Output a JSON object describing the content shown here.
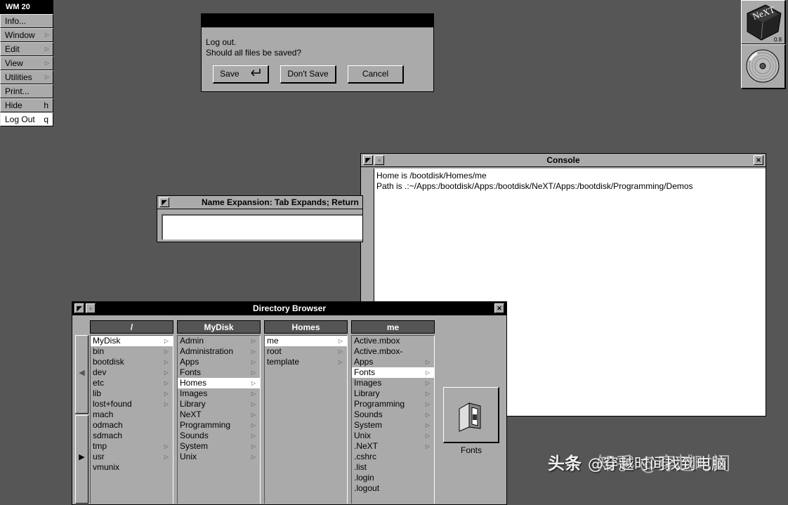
{
  "menu": {
    "title": "WM 20",
    "items": [
      {
        "label": "Info...",
        "key": "",
        "submenu": false
      },
      {
        "label": "Window",
        "key": "",
        "submenu": true
      },
      {
        "label": "Edit",
        "key": "",
        "submenu": true
      },
      {
        "label": "View",
        "key": "",
        "submenu": true
      },
      {
        "label": "Utilities",
        "key": "",
        "submenu": true
      },
      {
        "label": "Print...",
        "key": "",
        "submenu": false
      },
      {
        "label": "Hide",
        "key": "h",
        "submenu": false
      },
      {
        "label": "Log Out",
        "key": "q",
        "submenu": false
      }
    ]
  },
  "dialog": {
    "line1": "Log out.",
    "line2": "Should all files be saved?",
    "save": "Save",
    "dont_save": "Don't Save",
    "cancel": "Cancel"
  },
  "logo": {
    "text": "NeXT",
    "version": "0.8"
  },
  "console": {
    "title": "Console",
    "line1": "Home is /bootdisk/Homes/me",
    "line2": "Path is .:~/Apps:/bootdisk/Apps:/bootdisk/NeXT/Apps:/bootdisk/Programming/Demos"
  },
  "name_expansion": {
    "title": "Name Expansion:  Tab Expands; Return"
  },
  "browser": {
    "title": "Directory Browser",
    "columns": [
      {
        "header": "/",
        "rows": [
          {
            "name": "MyDisk",
            "dir": true,
            "sel": true
          },
          {
            "name": "bin",
            "dir": true
          },
          {
            "name": "bootdisk",
            "dir": true
          },
          {
            "name": "dev",
            "dir": true
          },
          {
            "name": "etc",
            "dir": true
          },
          {
            "name": "lib",
            "dir": true
          },
          {
            "name": "lost+found",
            "dir": true
          },
          {
            "name": "mach",
            "dir": false
          },
          {
            "name": "odmach",
            "dir": false
          },
          {
            "name": "sdmach",
            "dir": false
          },
          {
            "name": "tmp",
            "dir": true
          },
          {
            "name": "usr",
            "dir": true
          },
          {
            "name": "vmunix",
            "dir": false
          }
        ]
      },
      {
        "header": "MyDisk",
        "rows": [
          {
            "name": "Admin",
            "dir": true
          },
          {
            "name": "Administration",
            "dir": true
          },
          {
            "name": "Apps",
            "dir": true
          },
          {
            "name": "Fonts",
            "dir": true
          },
          {
            "name": "Homes",
            "dir": true,
            "sel": true
          },
          {
            "name": "Images",
            "dir": true
          },
          {
            "name": "Library",
            "dir": true
          },
          {
            "name": "NeXT",
            "dir": true
          },
          {
            "name": "Programming",
            "dir": true
          },
          {
            "name": "Sounds",
            "dir": true
          },
          {
            "name": "System",
            "dir": true
          },
          {
            "name": "Unix",
            "dir": true
          }
        ]
      },
      {
        "header": "Homes",
        "rows": [
          {
            "name": "me",
            "dir": true,
            "sel": true
          },
          {
            "name": "root",
            "dir": true
          },
          {
            "name": "template",
            "dir": true
          }
        ]
      },
      {
        "header": "me",
        "rows": [
          {
            "name": "Active.mbox",
            "dir": false
          },
          {
            "name": "Active.mbox-",
            "dir": false
          },
          {
            "name": "Apps",
            "dir": true
          },
          {
            "name": "Fonts",
            "dir": true,
            "sel": true
          },
          {
            "name": "Images",
            "dir": true
          },
          {
            "name": "Library",
            "dir": true
          },
          {
            "name": "Programming",
            "dir": true
          },
          {
            "name": "Sounds",
            "dir": true
          },
          {
            "name": "System",
            "dir": true
          },
          {
            "name": "Unix",
            "dir": true
          },
          {
            "name": ".NeXT",
            "dir": true
          },
          {
            "name": ".cshrc",
            "dir": false
          },
          {
            "name": ".list",
            "dir": false
          },
          {
            "name": ".login",
            "dir": false
          },
          {
            "name": ".logout",
            "dir": false
          }
        ]
      }
    ],
    "preview_label": "Fonts"
  },
  "watermark": {
    "prefix": "头条",
    "text": "@穿越时间找到电脑",
    "brand": "知乎 @穿越时间"
  }
}
